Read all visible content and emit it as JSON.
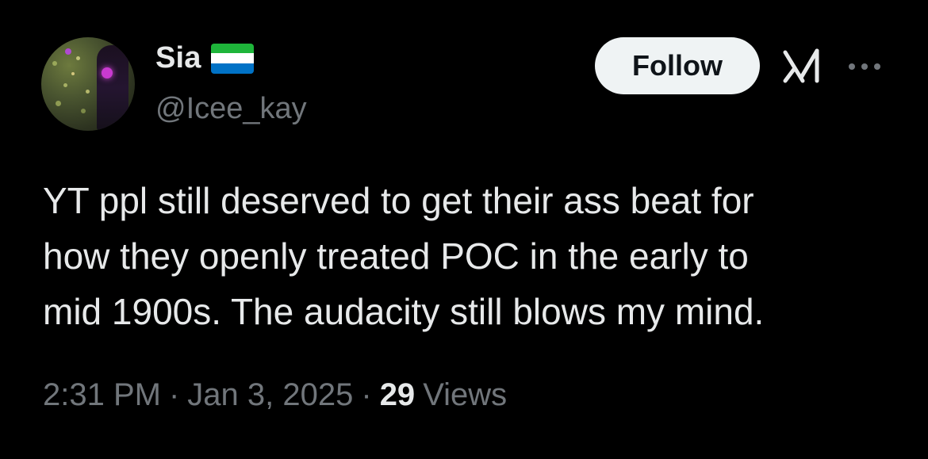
{
  "user": {
    "display_name": "Sia",
    "handle": "@Icee_kay",
    "flag_colors": [
      "#1eb53a",
      "#ffffff",
      "#0072c6"
    ]
  },
  "actions": {
    "follow_label": "Follow",
    "grok_icon": "grok-icon",
    "more_icon": "more-icon"
  },
  "tweet": {
    "text": "YT ppl still deserved to get their ass beat for\nhow they openly treated POC in the early to\nmid 1900s. The audacity still blows my mind."
  },
  "meta": {
    "time": "2:31 PM",
    "separator_1": "·",
    "date": "Jan 3, 2025",
    "separator_2": "·",
    "views_count": "29",
    "views_label": "Views"
  },
  "colors": {
    "background": "#000000",
    "primary_text": "#e7e9ea",
    "secondary_text": "#71767b",
    "follow_bg": "#eff3f4",
    "follow_text": "#0f1419"
  }
}
